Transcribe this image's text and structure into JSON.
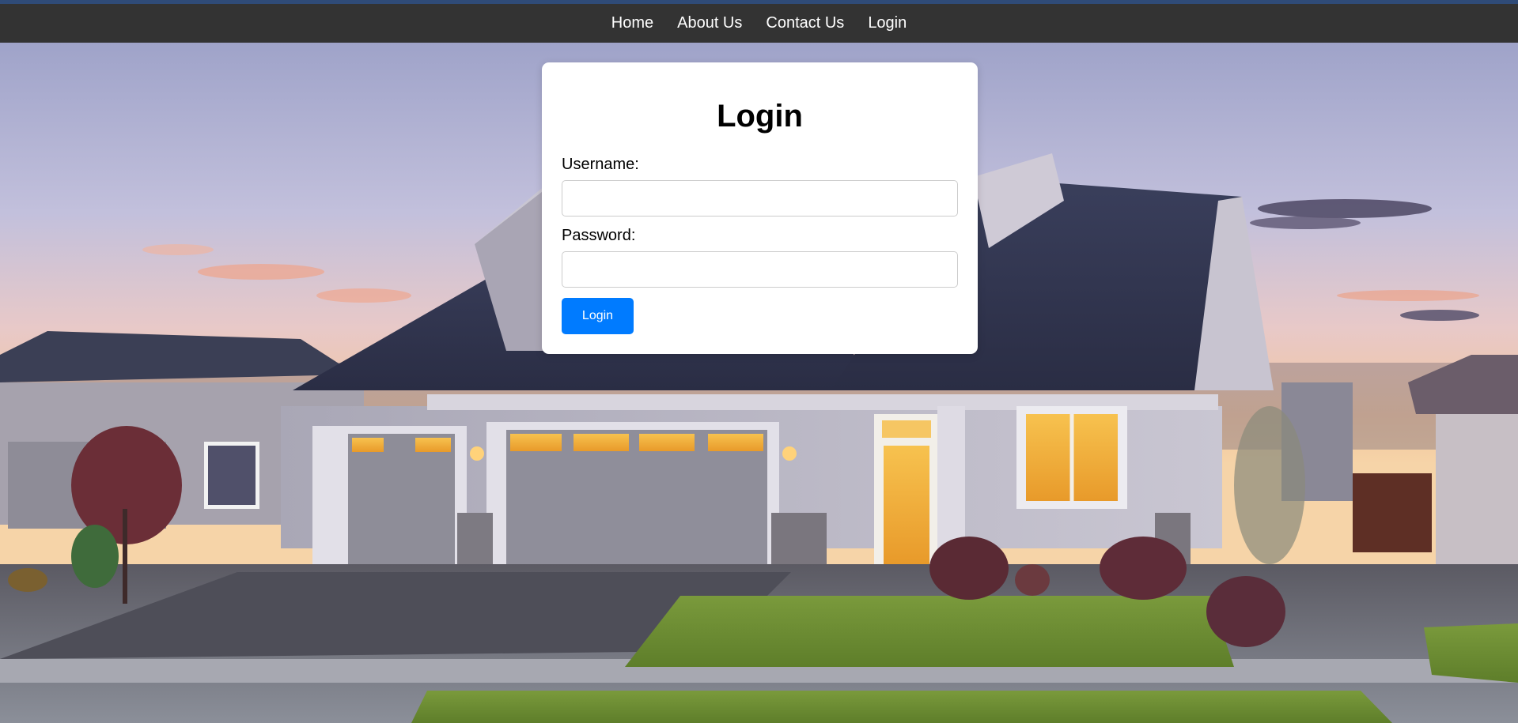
{
  "nav": {
    "items": [
      {
        "label": "Home"
      },
      {
        "label": "About Us"
      },
      {
        "label": "Contact Us"
      },
      {
        "label": "Login"
      }
    ]
  },
  "login": {
    "title": "Login",
    "username_label": "Username:",
    "username_value": "",
    "password_label": "Password:",
    "password_value": "",
    "submit_label": "Login"
  },
  "colors": {
    "navbar": "#333333",
    "accent": "#007bff",
    "card": "#ffffff"
  }
}
